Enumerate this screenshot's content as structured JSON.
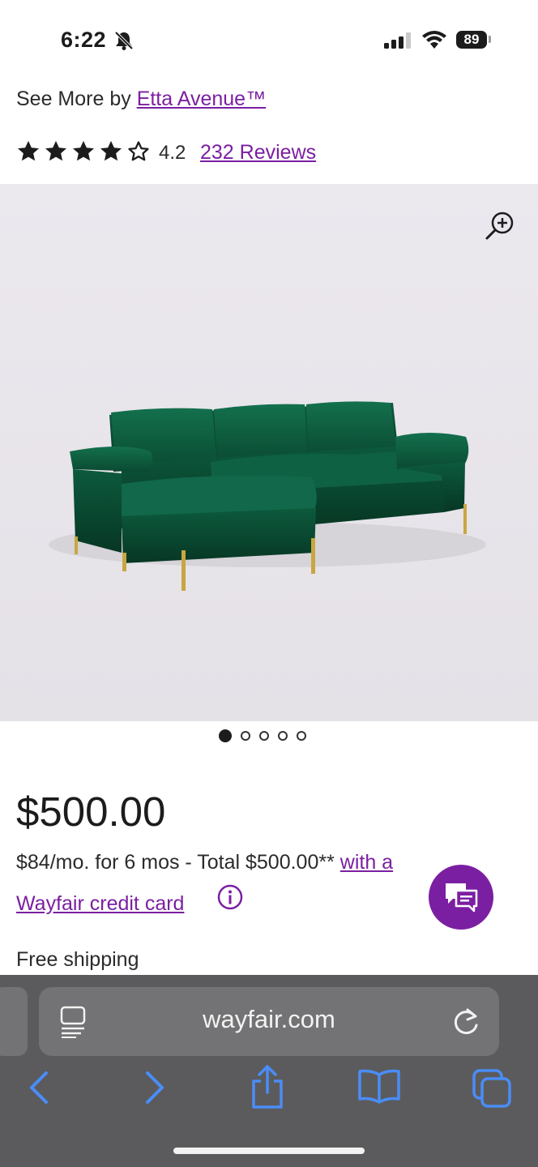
{
  "status_bar": {
    "time": "6:22",
    "battery": "89"
  },
  "product": {
    "see_more_prefix": "See More by ",
    "brand": "Etta Avenue™",
    "rating_value": "4.2",
    "rating_stars": 4,
    "reviews_link": "232 Reviews",
    "image_count": 5,
    "active_image_index": 0,
    "price": "$500.00",
    "financing_text": "$84/mo. for 6 mos - Total $500.00** ",
    "financing_link": "with a",
    "credit_card_link": "Wayfair credit card",
    "shipping": "Free shipping"
  },
  "browser": {
    "url": "wayfair.com"
  },
  "colors": {
    "brand_purple": "#7b1fa2",
    "sofa_green": "#0d5b3f",
    "leg_gold": "#c9a640"
  }
}
